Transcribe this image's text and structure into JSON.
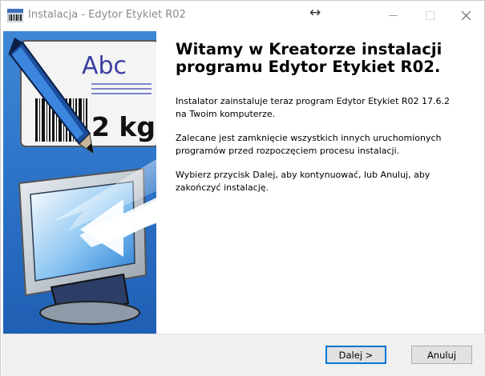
{
  "window": {
    "title": "Instalacja - Edytor Etykiet R02",
    "resize_symbol": "↔",
    "controls": [
      "minimize-icon",
      "maximize-icon",
      "close-icon"
    ]
  },
  "banner": {
    "abc_label": "Abc",
    "weight_label": "2 kg",
    "icons": [
      "pen-icon",
      "barcode-icon",
      "monitor-icon",
      "arrow-icon"
    ]
  },
  "welcome": {
    "heading": "Witamy w Kreatorze instalacji\nprogramu Edytor Etykiet R02.",
    "paragraphs": [
      "Instalator zainstaluje teraz program Edytor Etykiet R02 17.6.2\nna Twoim komputerze.",
      "Zalecane jest zamknięcie wszystkich innych uruchomionych\nprogramów przed rozpoczęciem procesu instalacji.",
      "Wybierz przycisk Dalej, aby kontynuować, lub Anuluj, aby\nzakończyć instalację."
    ]
  },
  "buttons": {
    "next": "Dalej >",
    "cancel": "Anuluj"
  },
  "colors": {
    "sidebar_blue": "#2c73c8",
    "accent": "#0078d7",
    "footer_bg": "#f0f0f0"
  }
}
